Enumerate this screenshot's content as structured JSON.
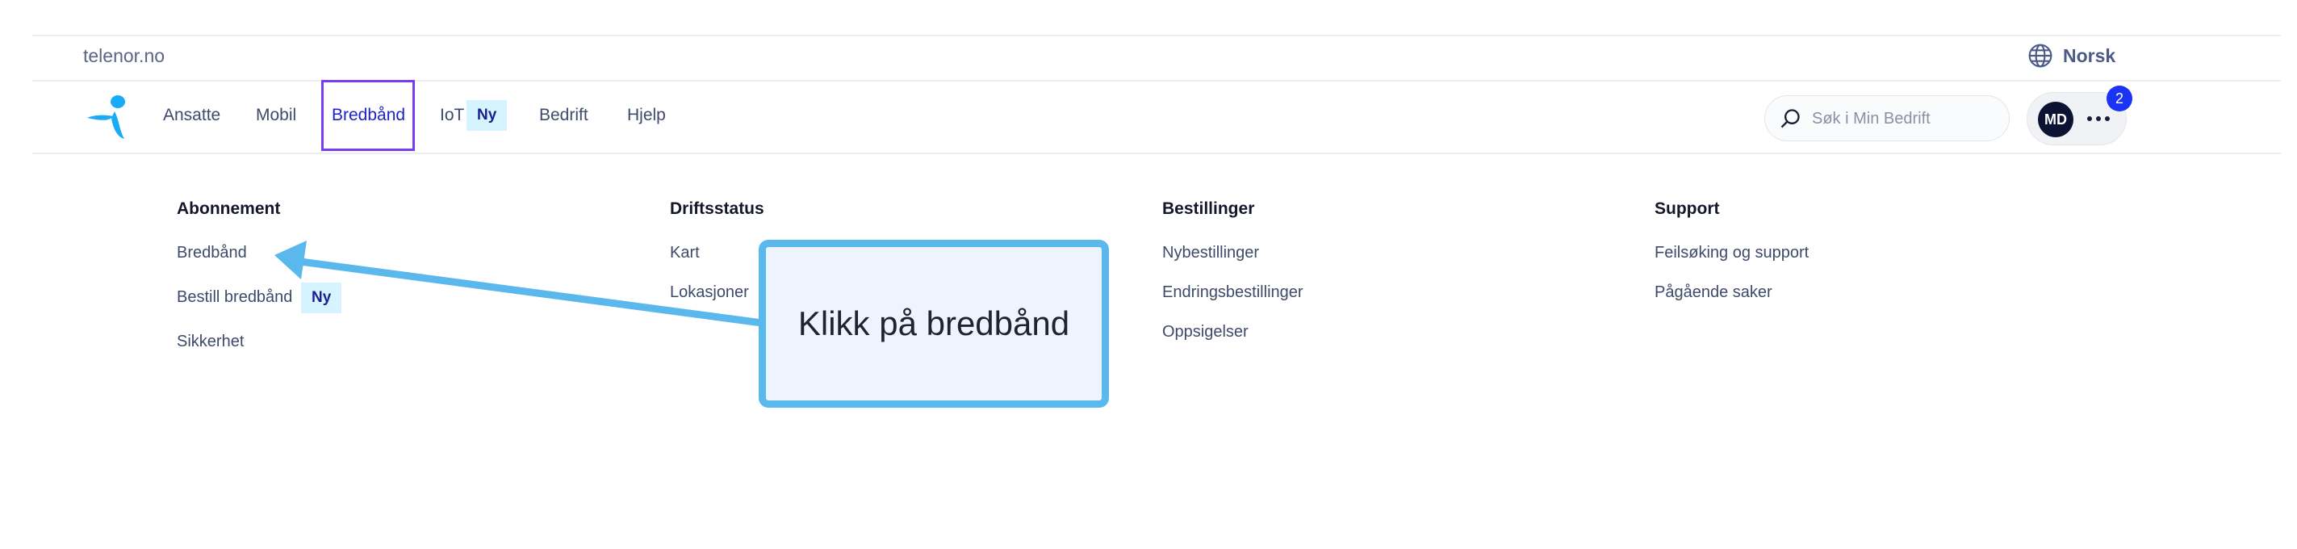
{
  "topbar": {
    "site": "telenor.no",
    "language": "Norsk",
    "language_icon": "globe-icon"
  },
  "nav": {
    "logo_icon": "telenor-logo",
    "items": [
      {
        "label": "Ansatte"
      },
      {
        "label": "Mobil"
      },
      {
        "label": "Bredbånd",
        "active": true
      },
      {
        "label": "IoT",
        "badge": "Ny"
      },
      {
        "label": "Bedrift"
      },
      {
        "label": "Hjelp"
      }
    ]
  },
  "search": {
    "placeholder": "Søk i Min Bedrift",
    "icon": "search-icon"
  },
  "user": {
    "initials": "MD",
    "notifications": "2",
    "menu_icon": "more-dots-icon"
  },
  "mega_menu": {
    "columns": [
      {
        "heading": "Abonnement",
        "links": [
          {
            "label": "Bredbånd"
          },
          {
            "label": "Bestill bredbånd",
            "badge": "Ny"
          },
          {
            "label": "Sikkerhet"
          }
        ]
      },
      {
        "heading": "Driftsstatus",
        "links": [
          {
            "label": "Kart"
          },
          {
            "label": "Lokasjoner"
          }
        ]
      },
      {
        "heading": "Bestillinger",
        "links": [
          {
            "label": "Nybestillinger"
          },
          {
            "label": "Endringsbestillinger"
          },
          {
            "label": "Oppsigelser"
          }
        ]
      },
      {
        "heading": "Support",
        "links": [
          {
            "label": "Feilsøking og support"
          },
          {
            "label": "Pågående saker"
          }
        ]
      }
    ]
  },
  "annotation": {
    "text": "Klikk på bredbånd",
    "color": "#5bb8ec"
  },
  "colors": {
    "active_nav": "#1a22c8",
    "highlight_box": "#7a3cf0",
    "badge_bg": "#d6f4ff",
    "notification": "#1a33f5"
  }
}
